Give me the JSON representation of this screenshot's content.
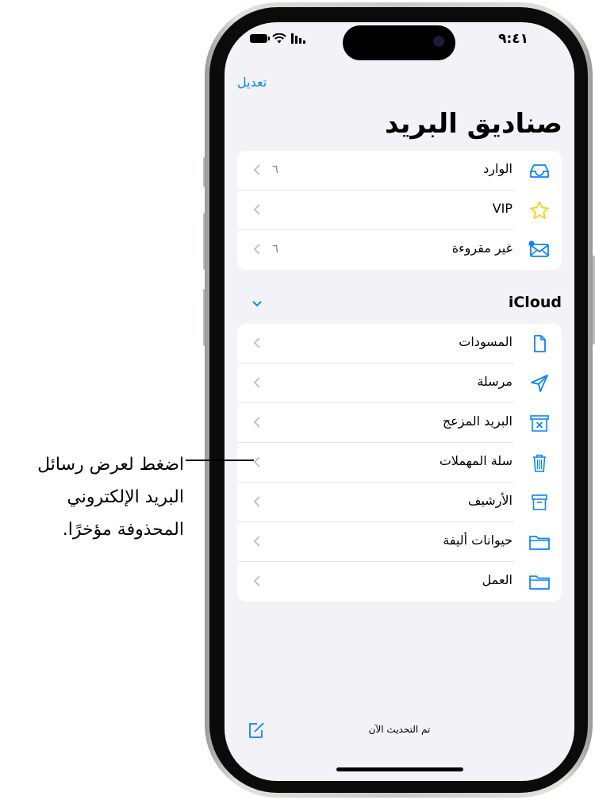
{
  "status": {
    "time": "٩:٤١"
  },
  "header": {
    "edit_label": "تعديل",
    "title": "صناديق البريد"
  },
  "mailboxes": [
    {
      "label": "الوارد",
      "count": "٦",
      "icon": "inbox-icon"
    },
    {
      "label": "VIP",
      "count": "",
      "icon": "star-icon"
    },
    {
      "label": "غير مقروءة",
      "count": "٦",
      "icon": "unread-envelope-icon"
    }
  ],
  "icloud": {
    "title": "iCloud",
    "folders": [
      {
        "label": "المسودات",
        "icon": "draft-document-icon"
      },
      {
        "label": "مرسلة",
        "icon": "paper-plane-icon"
      },
      {
        "label": "البريد المزعج",
        "icon": "junk-bin-icon"
      },
      {
        "label": "سلة المهملات",
        "icon": "trash-icon"
      },
      {
        "label": "الأرشيف",
        "icon": "archive-box-icon"
      },
      {
        "label": "حيوانات أليفة",
        "icon": "folder-icon"
      },
      {
        "label": "العمل",
        "icon": "folder-icon"
      }
    ]
  },
  "toolbar": {
    "status_text": "تم التحديث الآن"
  },
  "callout": {
    "text": "اضغط لعرض رسائل البريد الإلكتروني المحذوفة مؤخرًا."
  },
  "colors": {
    "accent": "#0a84ff",
    "background": "#f2f2f7",
    "star": "#ffcc00"
  }
}
